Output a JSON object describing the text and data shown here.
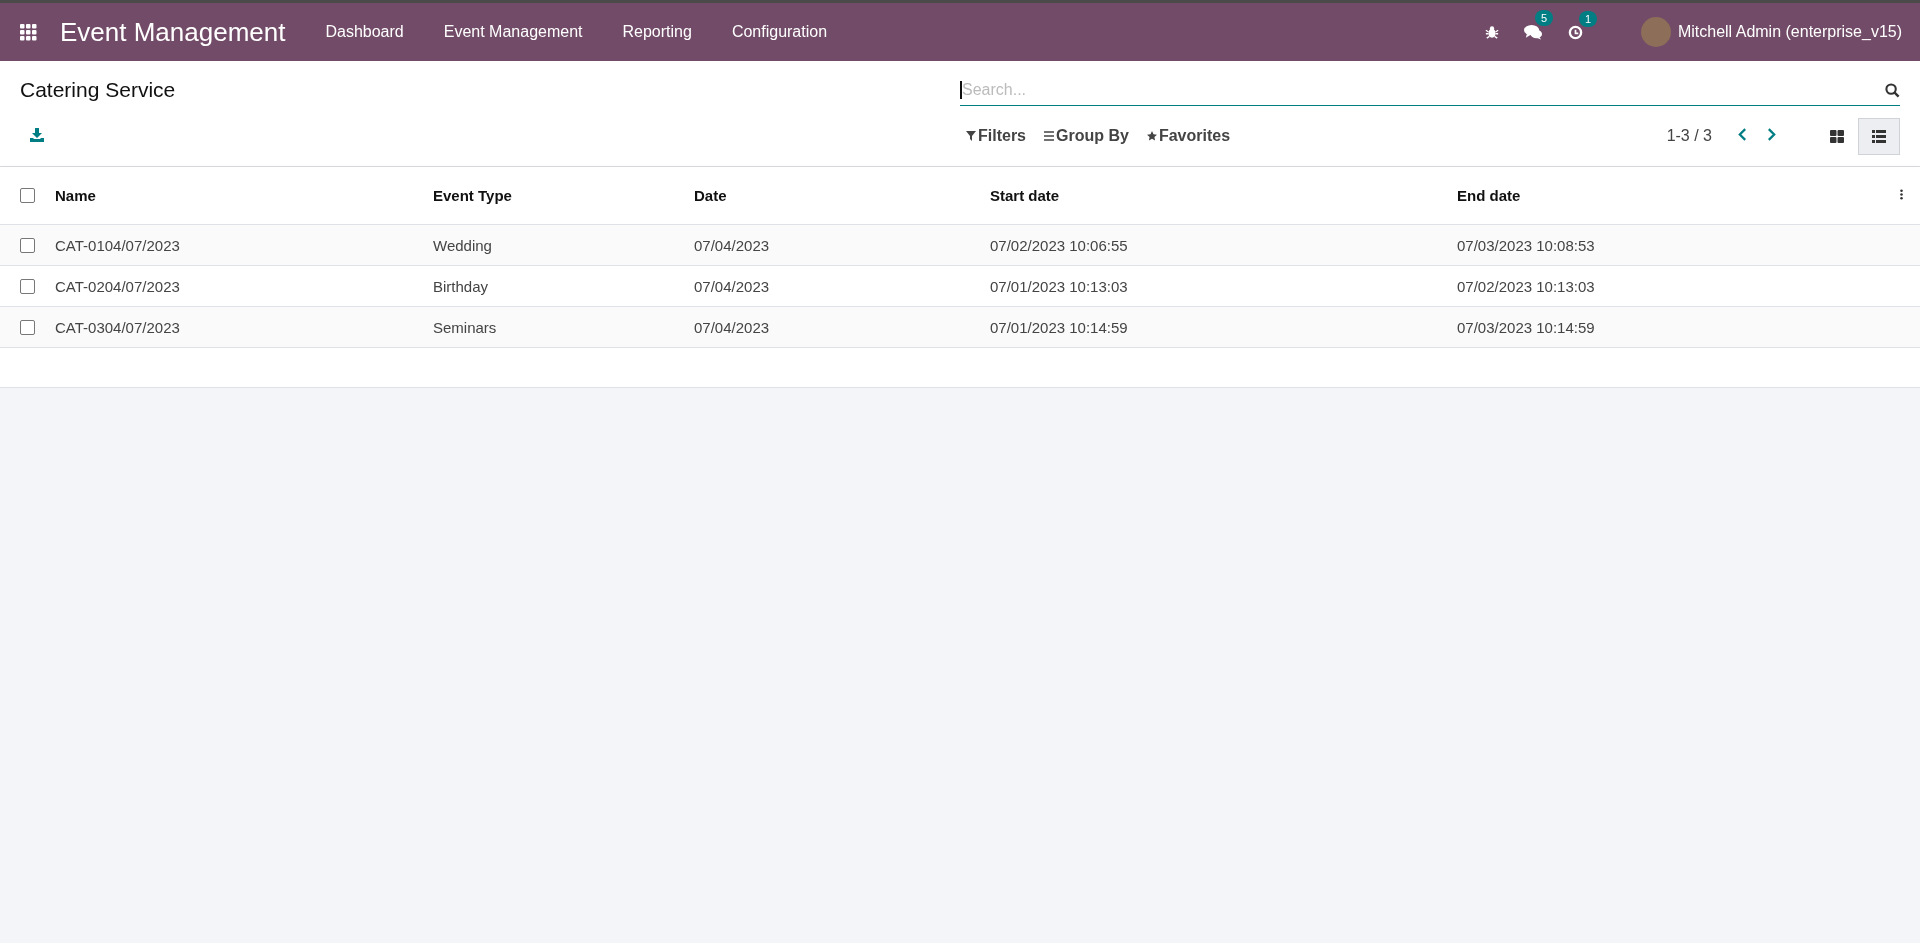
{
  "navbar": {
    "app_title": "Event Management",
    "menu": [
      {
        "label": "Dashboard"
      },
      {
        "label": "Event Management"
      },
      {
        "label": "Reporting"
      },
      {
        "label": "Configuration"
      }
    ],
    "messages_count": "5",
    "activities_count": "1",
    "user": "Mitchell Admin (enterprise_v15)"
  },
  "control_panel": {
    "title": "Catering Service",
    "search": {
      "placeholder": "Search..."
    },
    "filters": [
      {
        "kind": "filter",
        "label": "Filters"
      },
      {
        "kind": "group",
        "label": "Group By"
      },
      {
        "kind": "favorite",
        "label": "Favorites"
      }
    ],
    "pager": "1-3 / 3",
    "views": [
      {
        "kind": "kanban",
        "selected": false
      },
      {
        "kind": "list",
        "selected": true
      }
    ]
  },
  "table": {
    "select_all": {
      "checked": false
    },
    "columns": [
      "Name",
      "Event Type",
      "Date",
      "Start date",
      "End date"
    ],
    "rows": [
      {
        "checked": false,
        "cells": [
          "CAT-0104/07/2023",
          "Wedding",
          "07/04/2023",
          "07/02/2023 10:06:55",
          "07/03/2023 10:08:53"
        ]
      },
      {
        "checked": false,
        "cells": [
          "CAT-0204/07/2023",
          "Birthday",
          "07/04/2023",
          "07/01/2023 10:13:03",
          "07/02/2023 10:13:03"
        ]
      },
      {
        "checked": false,
        "cells": [
          "CAT-0304/07/2023",
          "Seminars",
          "07/04/2023",
          "07/01/2023 10:14:59",
          "07/03/2023 10:14:59"
        ]
      }
    ]
  }
}
